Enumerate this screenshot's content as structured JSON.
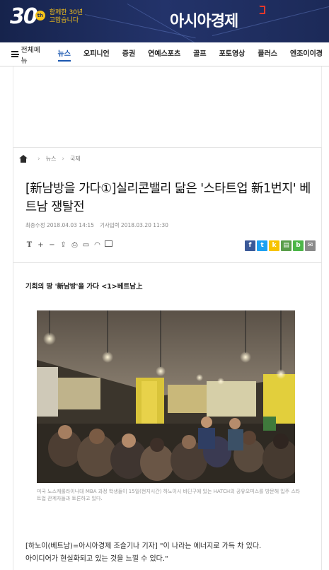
{
  "banner": {
    "anniversary_number": "30",
    "anniversary_suffix": "th",
    "anniversary_line1": "함께한 30년",
    "anniversary_line2": "고맙습니다",
    "brand": "아시아경제",
    "brand_color": "#e5382a",
    "background": "#1e2b5a"
  },
  "nav": {
    "menu_label": "전체메뉴",
    "items": [
      {
        "label": "뉴스",
        "active": true
      },
      {
        "label": "오피니언"
      },
      {
        "label": "증권"
      },
      {
        "label": "연예스포츠"
      },
      {
        "label": "골프"
      },
      {
        "label": "포토영상"
      },
      {
        "label": "플러스"
      },
      {
        "label": "엔조이이경"
      }
    ],
    "active_color": "#1a57b0"
  },
  "breadcrumb": [
    "뉴스",
    "국제"
  ],
  "article": {
    "headline": "[新남방을 가다①]실리콘밸리 닮은 '스타트업 新1번지' 베트남 쟁탈전",
    "modified": "최종수정 2018.04.03 14:15",
    "published": "기사입력 2018.03.20 11:30",
    "subhead": "기회의 땅 '新남방'을 가다 <1>베트남上",
    "caption": "미국 노스캐롤라이나대 MBA 과정 학생들이 15일(현지시간) 하노이시 바딘구에 있는 HATCH의 공유오피스를 방문해 입주 스타트업 관계자들과 토론하고 있다.",
    "body_line1": "[하노이(베트남)=아시아경제 조슬기나 기자] \"이 나라는 에너지로 가득 차 있다.",
    "body_line2": "아이디어가 현실화되고 있는 것을 느낄 수 있다.\""
  },
  "tools": {
    "font_size": "T",
    "zoom_in": "+",
    "zoom_out": "−"
  },
  "share_buttons": [
    {
      "name": "facebook-share",
      "glyph": "f",
      "color": "#3b5998"
    },
    {
      "name": "twitter-share",
      "glyph": "t",
      "color": "#1da1f2"
    },
    {
      "name": "kakaostory-share",
      "glyph": "k",
      "color": "#f7c300"
    },
    {
      "name": "band-share",
      "glyph": "▤",
      "color": "#5a9e4b"
    },
    {
      "name": "blog-share",
      "glyph": "b",
      "color": "#4cb648"
    },
    {
      "name": "email-share",
      "glyph": "✉",
      "color": "#8a8a8a"
    }
  ]
}
